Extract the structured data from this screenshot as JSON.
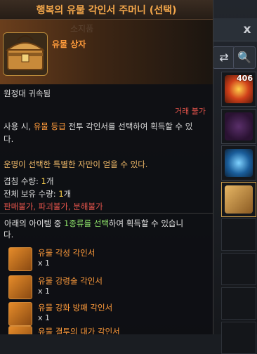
{
  "tooltip": {
    "title": "행복의 유물 각인서 주머니 (선택)",
    "item_name": "유물 상자",
    "binding": "원정대 귀속됨",
    "trade": "거래 불가",
    "use_line1_pre": "사용 시, ",
    "use_line1_hl": "유물 등급",
    "use_line1_post": " 전투 각인서를 선택하여 획득할 수 있",
    "use_line2": "다.",
    "flavor": "운명이 선택한 특별한 자만이 얻을 수 있다.",
    "stack_label": "겹침 수량: ",
    "stack_value": "1",
    "stack_unit": "개",
    "total_label": "전체 보유 수량: ",
    "total_value": "1",
    "total_unit": "개",
    "restrict_1": "판매불가",
    "restrict_2": "파괴불가",
    "restrict_3": "분해불가",
    "list_pre": "아래의 아이템 중 ",
    "list_hl": "1종류를 선택",
    "list_post": "하여 획득할 수 있습니",
    "list_end": "다.",
    "entries": [
      {
        "name": "유물 각성 각인서",
        "qty": "x 1"
      },
      {
        "name": "유물 강령술 각인서",
        "qty": "x 1"
      },
      {
        "name": "유물 강화 방패 각인서",
        "qty": "x 1"
      },
      {
        "name": "유물 결투의 대가 각인서",
        "qty": ""
      }
    ]
  },
  "background": {
    "close_glyph": "x",
    "slot_count": "406",
    "ghost_tab": "소지품"
  }
}
